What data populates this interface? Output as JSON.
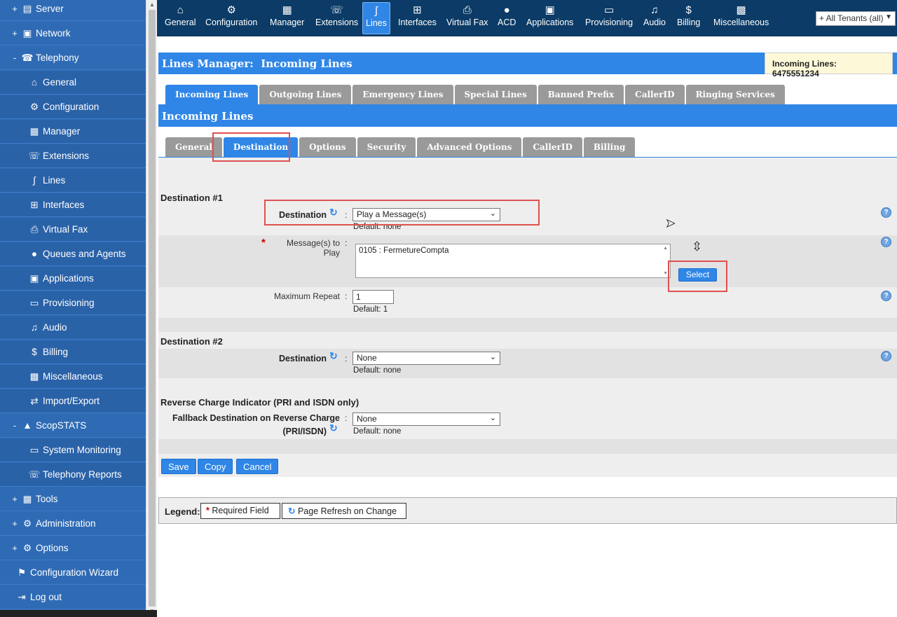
{
  "sidebar": {
    "items": [
      {
        "sign": "+",
        "label": "Server",
        "icon": "server-icon"
      },
      {
        "sign": "+",
        "label": "Network",
        "icon": "network-icon"
      },
      {
        "sign": "-",
        "label": "Telephony",
        "icon": "telephony-icon"
      },
      {
        "sign": "",
        "label": "General",
        "icon": "home-icon"
      },
      {
        "sign": "",
        "label": "Configuration",
        "icon": "gear-icon"
      },
      {
        "sign": "",
        "label": "Manager",
        "icon": "manager-icon"
      },
      {
        "sign": "",
        "label": "Extensions",
        "icon": "phone-icon"
      },
      {
        "sign": "",
        "label": "Lines",
        "icon": "lines-icon"
      },
      {
        "sign": "",
        "label": "Interfaces",
        "icon": "interfaces-icon"
      },
      {
        "sign": "",
        "label": "Virtual Fax",
        "icon": "fax-icon"
      },
      {
        "sign": "",
        "label": "Queues and Agents",
        "icon": "agent-icon"
      },
      {
        "sign": "",
        "label": "Applications",
        "icon": "applications-icon"
      },
      {
        "sign": "",
        "label": "Provisioning",
        "icon": "provisioning-icon"
      },
      {
        "sign": "",
        "label": "Audio",
        "icon": "music-note-icon"
      },
      {
        "sign": "",
        "label": "Billing",
        "icon": "money-bag-icon"
      },
      {
        "sign": "",
        "label": "Miscellaneous",
        "icon": "misc-grid-icon"
      },
      {
        "sign": "",
        "label": "Import/Export",
        "icon": "import-export-icon"
      },
      {
        "sign": "-",
        "label": "ScopSTATS",
        "icon": "chart-icon"
      },
      {
        "sign": "",
        "label": "System Monitoring",
        "icon": "monitor-icon"
      },
      {
        "sign": "",
        "label": "Telephony Reports",
        "icon": "phone-report-icon"
      },
      {
        "sign": "+",
        "label": "Tools",
        "icon": "tools-icon"
      },
      {
        "sign": "+",
        "label": "Administration",
        "icon": "admin-gears-icon"
      },
      {
        "sign": "+",
        "label": "Options",
        "icon": "gear-icon"
      },
      {
        "sign": "",
        "label": "Configuration Wizard",
        "icon": "wizard-icon"
      },
      {
        "sign": "",
        "label": "Log out",
        "icon": "logout-icon"
      }
    ]
  },
  "topnav": {
    "items": [
      {
        "label": "General",
        "icon": "home-icon"
      },
      {
        "label": "Configuration",
        "icon": "gear-icon"
      },
      {
        "label": "Manager",
        "icon": "manager-icon"
      },
      {
        "label": "Extensions",
        "icon": "phone-icon"
      },
      {
        "label": "Lines",
        "icon": "lines-icon"
      },
      {
        "label": "Interfaces",
        "icon": "interfaces-icon"
      },
      {
        "label": "Virtual Fax",
        "icon": "fax-icon"
      },
      {
        "label": "ACD",
        "icon": "agent-icon"
      },
      {
        "label": "Applications",
        "icon": "applications-icon"
      },
      {
        "label": "Provisioning",
        "icon": "provisioning-icon"
      },
      {
        "label": "Audio",
        "icon": "music-note-icon"
      },
      {
        "label": "Billing",
        "icon": "money-bag-icon"
      },
      {
        "label": "Miscellaneous",
        "icon": "misc-grid-icon"
      }
    ],
    "tenant_select": "+ All Tenants (all)"
  },
  "page": {
    "title": "Lines Manager:  Incoming Lines",
    "badge": "Incoming Lines: 6475551234",
    "section_title": "Incoming Lines"
  },
  "tabs_top": [
    "Incoming Lines",
    "Outgoing Lines",
    "Emergency Lines",
    "Special Lines",
    "Banned Prefix",
    "CallerID",
    "Ringing Services"
  ],
  "tabs_sub": [
    "General",
    "Destination",
    "Options",
    "Security",
    "Advanced Options",
    "CallerID",
    "Billing"
  ],
  "form": {
    "dest1_heading": "Destination #1",
    "dest1_label": "Destination",
    "dest1_value": "Play a Message(s)",
    "dest1_default": "Default: none",
    "messages_label": "Message(s) to Play",
    "messages_value": "0105 : FermetureCompta",
    "select_button": "Select",
    "max_repeat_label": "Maximum Repeat",
    "max_repeat_value": "1",
    "max_repeat_default": "Default: 1",
    "dest2_heading": "Destination #2",
    "dest2_label": "Destination",
    "dest2_value": "None",
    "dest2_default": "Default: none",
    "rci_heading": "Reverse Charge Indicator (PRI and ISDN only)",
    "fallback_label_1": "Fallback Destination on Reverse Charge",
    "fallback_label_2": "(PRI/ISDN)",
    "fallback_value": "None",
    "fallback_default": "Default: none",
    "colon": ":",
    "required_star": "*",
    "help_mark": "?"
  },
  "buttons": {
    "save": "Save",
    "copy": "Copy",
    "cancel": "Cancel"
  },
  "legend": {
    "label": "Legend:",
    "required": "Required Field",
    "refresh": "Page Refresh on Change"
  },
  "colors": {
    "primary_blue": "#2f86e6",
    "nav_dark": "#0b3b66",
    "sidebar_blue": "#2f6bb5",
    "highlight_red": "#e05050"
  }
}
